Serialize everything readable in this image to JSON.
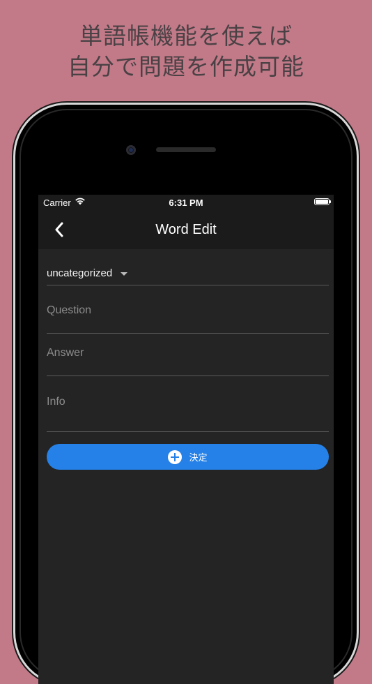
{
  "promo": {
    "line1": "単語帳機能を使えば",
    "line2": "自分で問題を作成可能"
  },
  "status_bar": {
    "carrier": "Carrier",
    "time": "6:31 PM",
    "wifi_icon": "wifi-icon",
    "battery_icon": "battery-icon"
  },
  "app_bar": {
    "title": "Word Edit",
    "back_icon": "chevron-left-icon"
  },
  "form": {
    "category": {
      "selected": "uncategorized"
    },
    "question": {
      "value": "",
      "placeholder": "Question"
    },
    "answer": {
      "value": "",
      "placeholder": "Answer"
    },
    "info": {
      "value": "",
      "placeholder": "Info"
    },
    "submit": {
      "label": "決定",
      "icon": "plus-circle-icon"
    }
  },
  "colors": {
    "background": "#c27a88",
    "screen": "#242424",
    "app_bar": "#1b1b1b",
    "accent": "#2581e7"
  }
}
